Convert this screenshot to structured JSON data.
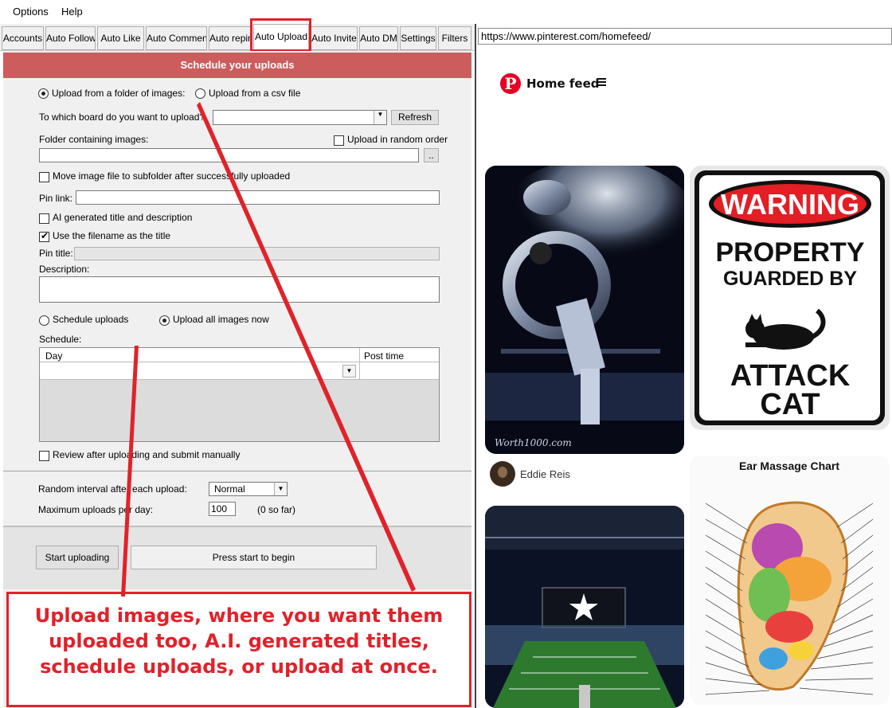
{
  "menu": {
    "items": [
      "Options",
      "Help"
    ]
  },
  "tabs": [
    {
      "label": "Accounts"
    },
    {
      "label": "Auto Follow"
    },
    {
      "label": "Auto Like"
    },
    {
      "label": "Auto Comment"
    },
    {
      "label": "Auto repin"
    },
    {
      "label": "Auto Upload",
      "active": true
    },
    {
      "label": "Auto Invite"
    },
    {
      "label": "Auto DM"
    },
    {
      "label": "Settings"
    },
    {
      "label": "Filters"
    }
  ],
  "upload": {
    "header": "Schedule your uploads",
    "source_folder_label": "Upload from a folder of images:",
    "source_folder_selected": true,
    "source_csv_label": "Upload from a csv file",
    "board_label": "To which board do you want to upload?",
    "board_value": "",
    "refresh_label": "Refresh",
    "folder_label": "Folder containing images:",
    "folder_value": "",
    "browse_label": "..",
    "random_order_label": "Upload in random order",
    "random_order_checked": false,
    "move_file_label": "Move image file to subfolder after successfully uploaded",
    "move_file_checked": false,
    "pin_link_label": "Pin link:",
    "pin_link_value": "",
    "ai_label": "AI generated title and description",
    "ai_checked": false,
    "use_filename_label": "Use the filename as the title",
    "use_filename_checked": true,
    "pin_title_label": "Pin title:",
    "pin_title_value": "",
    "description_label": "Description:",
    "description_value": "",
    "schedule_uploads_label": "Schedule uploads",
    "upload_now_label": "Upload all images now",
    "upload_now_selected": true,
    "schedule_label": "Schedule:",
    "schedule_columns": [
      "Day",
      "Post time"
    ],
    "review_label": "Review after uploading and submit manually",
    "review_checked": false,
    "interval_label": "Random interval after each upload:",
    "interval_value": "Normal",
    "max_label": "Maximum uploads per day:",
    "max_value": "100",
    "so_far": "(0 so far)",
    "start_label": "Start uploading",
    "status_text": "Press start to begin"
  },
  "browser": {
    "url": "https://www.pinterest.com/homefeed/",
    "feed_title": "Home feed",
    "menu_icon": "hamburger-icon",
    "pins": [
      {
        "name": "kiss-tuba",
        "user": "Eddie Reis",
        "watermark": "Worth1000.com"
      },
      {
        "name": "warning-sign",
        "sign_top": "WARNING",
        "sign_mid1": "PROPERTY",
        "sign_mid2": "GUARDED BY",
        "sign_bot1": "ATTACK",
        "sign_bot2": "CAT"
      },
      {
        "name": "stadium"
      },
      {
        "name": "ear-chart",
        "title": "Ear Massage Chart"
      }
    ]
  },
  "annotation": {
    "text": "Upload images, where you want them uploaded too, A.I. generated titles, schedule uploads, or upload at once.",
    "color": "#e0222a"
  },
  "colors": {
    "header": "#cd5c5c",
    "accent_red": "#e0222a",
    "pinterest": "#e60023"
  }
}
